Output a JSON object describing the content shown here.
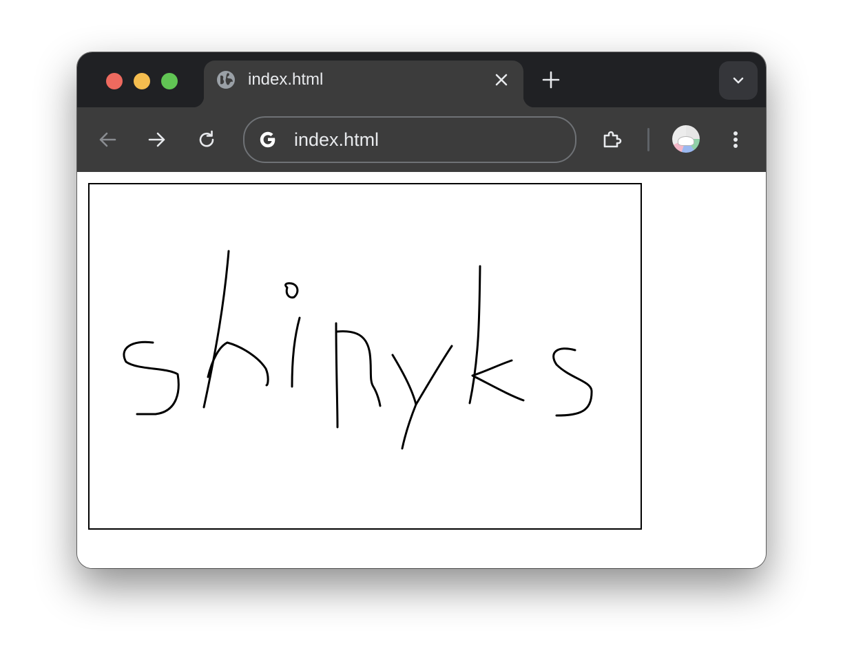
{
  "tab": {
    "title": "index.html",
    "favicon": "globe-icon",
    "close_icon": "close-icon"
  },
  "tabstrip": {
    "new_tab_icon": "plus-icon",
    "tab_search_icon": "chevron-down-icon"
  },
  "toolbar": {
    "back_icon": "arrow-left-icon",
    "forward_icon": "arrow-right-icon",
    "reload_icon": "reload-icon",
    "extensions_icon": "puzzle-icon",
    "menu_icon": "kebab-menu-icon",
    "profile_icon": "avatar"
  },
  "omnibox": {
    "url": "index.html",
    "site_icon": "google-g-icon"
  },
  "page": {
    "handwritten_text": "shinyks",
    "stroke_color": "#000000",
    "canvas_border_color": "#000000"
  },
  "colors": {
    "tabstrip_bg": "#202124",
    "toolbar_bg": "#3c3c3c",
    "text": "#e8eaed",
    "traffic_red": "#ee6a5f",
    "traffic_yellow": "#f5bd4f",
    "traffic_green": "#61c554"
  }
}
